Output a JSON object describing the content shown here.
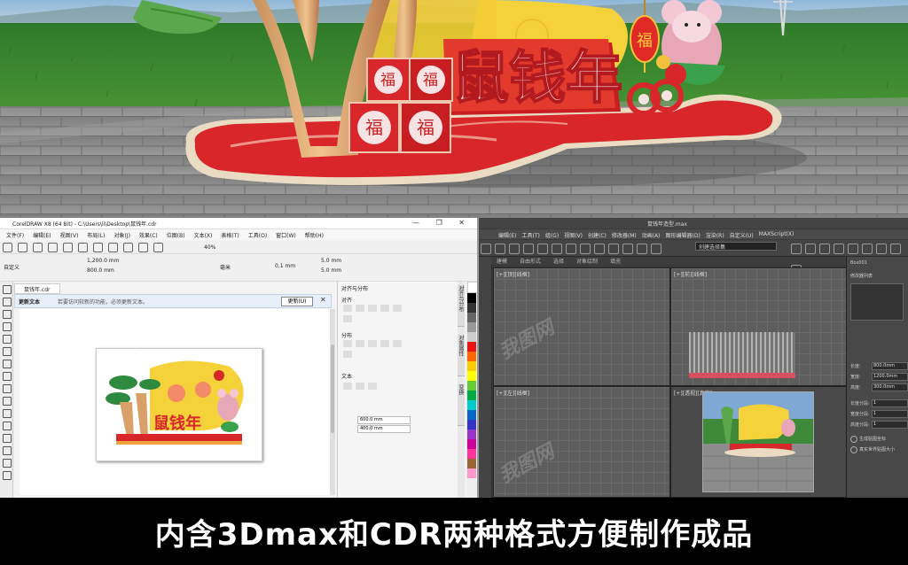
{
  "scene": {
    "sign_title": "鼠钱年",
    "fu_char": "福"
  },
  "cdr": {
    "window_title": "CorelDRAW X8 (64 Bit) - C:\\Users\\li\\Desktop\\鼠钱年.cdr",
    "window_buttons": "—  ❐  ✕",
    "menu": [
      "文件(F)",
      "编辑(E)",
      "视图(V)",
      "布局(L)",
      "对象(J)",
      "效果(C)",
      "位图(B)",
      "文本(X)",
      "表格(T)",
      "工具(O)",
      "窗口(W)",
      "帮助(H)"
    ],
    "zoom": "40%",
    "preset_label": "自定义",
    "dims": {
      "w": "1,200.0 mm",
      "h": "800.0 mm"
    },
    "unit_label": "毫米",
    "nudge": "0.1 mm",
    "dup": {
      "x": "5.0 mm",
      "y": "5.0 mm"
    },
    "doc_tab": "鼠钱年.cdr",
    "notice_title": "更新文本",
    "notice_text": "若要访问较新的功能，必须更新文本。",
    "update_button": "更新(U)",
    "dock_title": "对齐与分布",
    "dock_group1": "对齐",
    "dock_group2": "分布",
    "dock_group3": "文本",
    "dock_field1": "600.0 mm",
    "dock_field2": "400.0 mm",
    "dock_tabs": [
      "对齐与分布",
      "对象属性",
      "变换"
    ],
    "page_title": "鼠钱年"
  },
  "max": {
    "window_title": "鼠钱年造型.max",
    "menu": [
      "编辑(E)",
      "工具(T)",
      "组(G)",
      "视图(V)",
      "创建(C)",
      "修改器(M)",
      "动画(A)",
      "图形编辑器(D)",
      "渲染(R)",
      "自定义(U)",
      "MAXScript(X)"
    ],
    "selection_set": "创建选择集",
    "viewport_tabs": [
      "建模",
      "自由形式",
      "选择",
      "对象绘制",
      "填充"
    ],
    "viewport_labels": [
      "[+][顶][线框]",
      "[+][前][线框]",
      "[+][左][线框]",
      "[+][透视][真实]"
    ],
    "cmd_title": "Box001",
    "cmd_modifier": "修改器列表",
    "params": [
      {
        "label": "长度:",
        "value": "800.0mm"
      },
      {
        "label": "宽度:",
        "value": "1200.0mm"
      },
      {
        "label": "高度:",
        "value": "300.0mm"
      },
      {
        "label": "长度分段:",
        "value": "1"
      },
      {
        "label": "宽度分段:",
        "value": "1"
      },
      {
        "label": "高度分段:",
        "value": "1"
      }
    ],
    "checks": [
      "生成贴图坐标",
      "真实世界贴图大小"
    ]
  },
  "caption": "内含3Dmax和CDR两种格式方便制作成品",
  "watermark": "我图网",
  "colors": {
    "sign_red": "#d8262a",
    "sign_yellow": "#f6d23a",
    "grass": "#3d8a2e",
    "pavement": "#8b8b8b",
    "base": "#e9dcc2"
  }
}
